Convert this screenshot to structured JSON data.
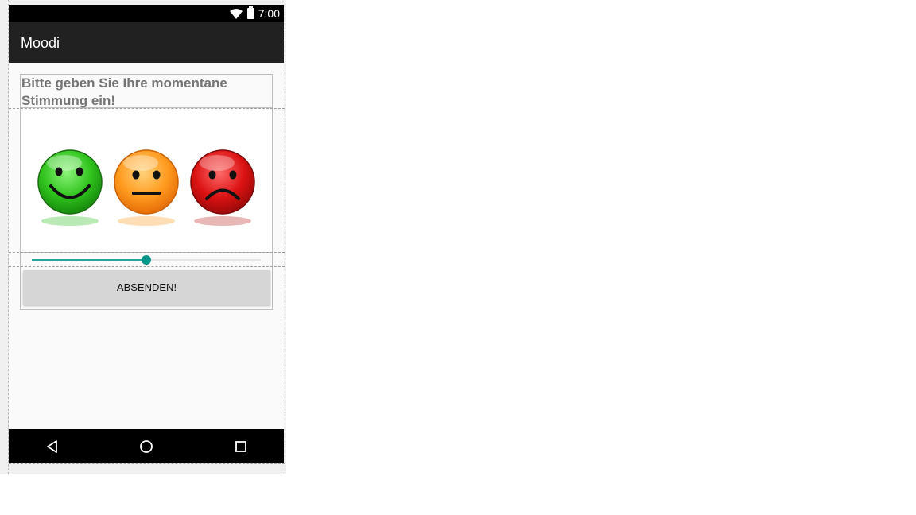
{
  "status_bar": {
    "time": "7:00"
  },
  "app_bar": {
    "title": "Moodi"
  },
  "main": {
    "prompt": "Bitte geben Sie Ihre momentane Stimmung ein!",
    "mood_slider": {
      "value": 0.5
    },
    "submit_label": "ABSENDEN!"
  },
  "colors": {
    "accent": "#009688",
    "appbar": "#212121"
  },
  "icons": {
    "smileys": [
      "happy-green-face",
      "neutral-orange-face",
      "sad-red-face"
    ],
    "nav": [
      "back-icon",
      "home-icon",
      "recents-icon"
    ]
  }
}
